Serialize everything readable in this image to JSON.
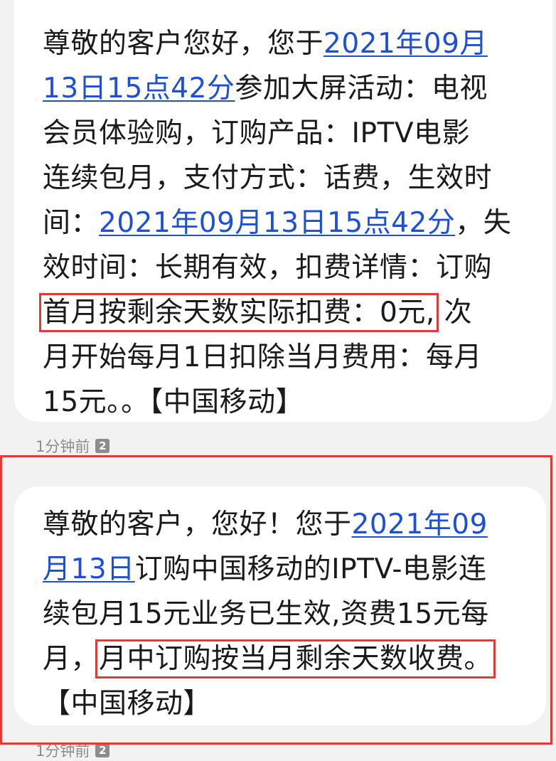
{
  "messages": [
    {
      "lines": [
        {
          "pre": "尊敬的客户您好，您于",
          "link": "2021年09月"
        },
        {
          "link": "13日15点42分",
          "post": "参加大屏活动：电视"
        },
        {
          "text": "会员体验购，订购产品：IPTV电影"
        },
        {
          "text": "连续包月，支付方式：话费，生效时"
        },
        {
          "pre": "间：",
          "link": "2021年09月13日15点42分",
          "post": "，失"
        },
        {
          "text": "效时间：长期有效，扣费详情：订购"
        },
        {
          "highlight": "首月按剩余天数实际扣费：0元,",
          "post": "次"
        },
        {
          "text": "月开始每月1日扣除当月费用：每月"
        },
        {
          "text": "15元。。【中国移动】"
        }
      ],
      "time": "1分钟前",
      "sim": "2"
    },
    {
      "lines": [
        {
          "pre": "尊敬的客户，您好！您于",
          "link": "2021年09"
        },
        {
          "link": "月13日",
          "post": "订购中国移动的IPTV-电影连"
        },
        {
          "text": "续包月15元业务已生效,资费15元每"
        },
        {
          "pre": "月，",
          "highlight": "月中订购按当月剩余天数收费。"
        },
        {
          "text": "【中国移动】"
        }
      ],
      "time": "1分钟前",
      "sim": "2"
    }
  ],
  "colors": {
    "background": "#f2f2f2",
    "bubble": "#ffffff",
    "link": "#1d4fd8",
    "highlight_box": "#e53935",
    "meta_text": "#8c8c8c"
  }
}
